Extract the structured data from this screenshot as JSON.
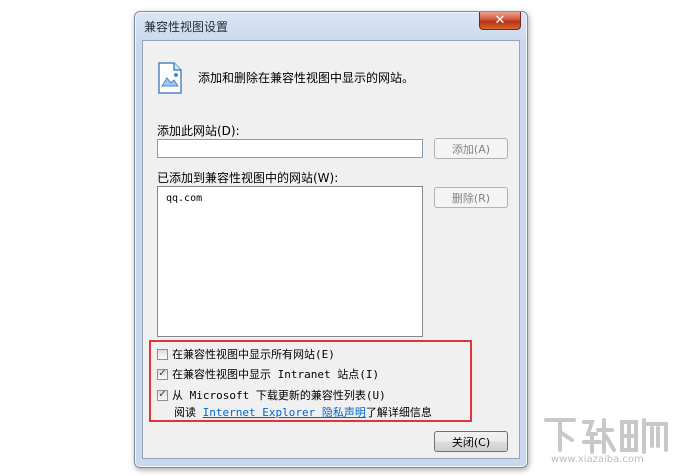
{
  "dialog": {
    "title": "兼容性视图设置",
    "close_glyph": "✕",
    "header_text": "添加和删除在兼容性视图中显示的网站。",
    "add_label": "添加此网站(D):",
    "url_value": "",
    "add_button": "添加(A)",
    "list_label": "已添加到兼容性视图中的网站(W):",
    "sites": [
      "qq.com"
    ],
    "remove_button": "删除(R)",
    "options": [
      {
        "label": "在兼容性视图中显示所有网站(E)",
        "checked": false
      },
      {
        "label": "在兼容性视图中显示 Intranet 站点(I)",
        "checked": true
      },
      {
        "label": "从 Microsoft 下载更新的兼容性列表(U)",
        "checked": true
      }
    ],
    "read_prefix": "阅读 ",
    "privacy_link": "Internet Explorer 隐私声明",
    "read_suffix": "了解详细信息",
    "close_button": "关闭(C)"
  },
  "watermark": {
    "text": "www.xiazaiba.com"
  },
  "colors": {
    "highlight": "#e0343a",
    "link": "#0066cc",
    "title_bar": "#c9d8ec"
  }
}
